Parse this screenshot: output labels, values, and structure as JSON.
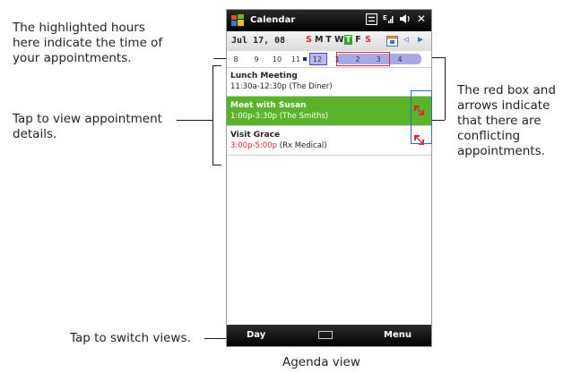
{
  "annotations": {
    "highlight_hours": [
      "The highlighted hours",
      "here indicate the time of",
      "your appointments."
    ],
    "tap_details": [
      "Tap to view appointment",
      "details."
    ],
    "conflict": [
      "The red box and",
      "arrows indicate",
      "that there are",
      "conflicting",
      "appointments."
    ],
    "switch_views": "Tap to switch views.",
    "caption": "Agenda view"
  },
  "titlebar": {
    "title": "Calendar",
    "status_icons": [
      "grid-icon",
      "signal-icon",
      "speaker-icon",
      "close-icon"
    ],
    "close": "✕"
  },
  "datebar": {
    "date": "Jul 17, 08",
    "days": [
      "S",
      "M",
      "T",
      "W",
      "T",
      "F",
      "S"
    ],
    "today_index": 4
  },
  "hours": {
    "labels": [
      "8",
      "9",
      "10",
      "11",
      "12",
      "1",
      "2",
      "3",
      "4"
    ]
  },
  "appointments": [
    {
      "name": "Lunch Meeting",
      "time": "11:30a-12:30p",
      "location": "(The Diner)",
      "conflict": false,
      "selected": false,
      "time_red": false
    },
    {
      "name": "Meet with Susan",
      "time": "1:00p-3:30p",
      "location": "(The Smiths)",
      "conflict": true,
      "selected": true,
      "time_red": false
    },
    {
      "name": "Visit Grace",
      "time": "3:00p-5:00p",
      "location": "(Rx Medical)",
      "conflict": true,
      "selected": false,
      "time_red": true
    }
  ],
  "softbar": {
    "left": "Day",
    "right": "Menu"
  },
  "colors": {
    "selected_bg": "#5bb32a",
    "conflict_red": "#e0262d",
    "busy": "#a9a9e8",
    "frame_blue": "#2e6bc5"
  }
}
